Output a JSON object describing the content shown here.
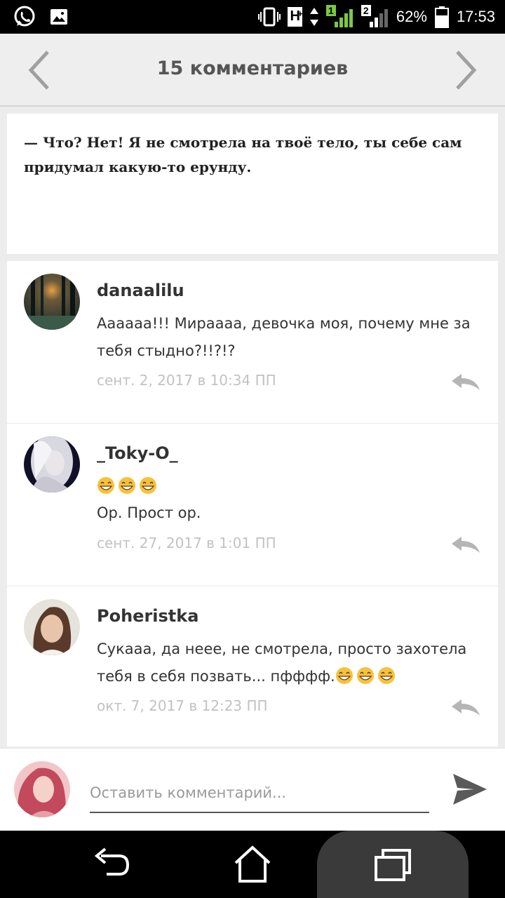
{
  "status_bar": {
    "network_type": "H",
    "network_plus": "+",
    "sim1_badge": "1",
    "sim2_badge": "2",
    "battery_percent": "62%",
    "time": "17:53",
    "icons": [
      "whatsapp-icon",
      "image-icon",
      "vibrate-icon",
      "network-type-icon",
      "signal-icon",
      "battery-icon"
    ]
  },
  "header": {
    "title": "15 комментариев",
    "prev_icon": "chevron-left-icon",
    "next_icon": "chevron-right-icon"
  },
  "quote": {
    "text": "— Что? Нет! Я не смотрела на твоё тело, ты себе сам придумал какую-то ерунду."
  },
  "comments": [
    {
      "author": "danaalilu",
      "text": "Аааааа!!! Мирaaaa, девочка моя, почему мне за тебя стыдно?!!?!?",
      "date": "сент. 2, 2017 в 10:34 ПП"
    },
    {
      "author": "_Toky-O_",
      "emojis": "😁😁😁",
      "text": "Ор. Прост ор.",
      "date": "сент. 27, 2017 в 1:01 ПП"
    },
    {
      "author": "Poheristka",
      "text": "Сукааа, да нeee, не смотрела, просто захотела тебя в себя позвать... пфффф.",
      "emojis": "😁😁😁",
      "date": "окт. 7, 2017 в 12:23 ПП"
    }
  ],
  "composer": {
    "placeholder": "Оставить комментарий...",
    "send_icon": "send-icon"
  },
  "nav_bar": {
    "icons": [
      "back-icon",
      "home-icon",
      "recents-icon"
    ]
  },
  "colors": {
    "header_bg": "#eeeeee",
    "card_bg": "#ffffff",
    "page_bg": "#ececec",
    "date_text": "#c2c2c2",
    "reply_icon": "#b5b5b5"
  }
}
